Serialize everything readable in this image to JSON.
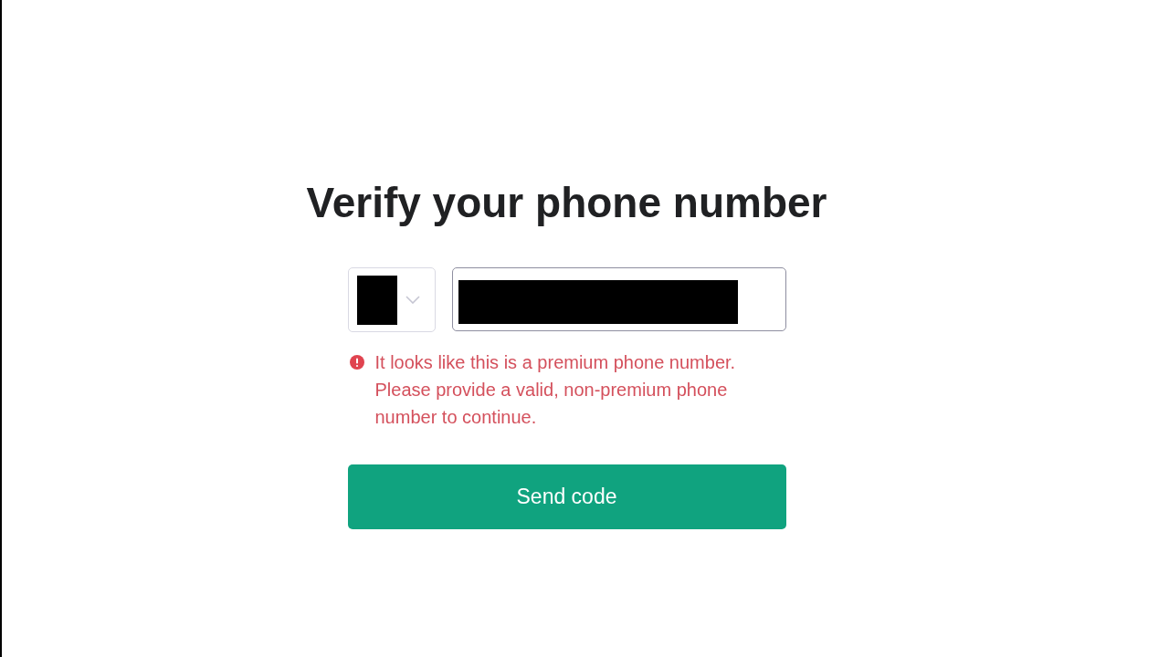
{
  "heading": "Verify your phone number",
  "country_select": {
    "redacted": true
  },
  "phone_field": {
    "redacted": true
  },
  "error": {
    "kind": "error",
    "text": "It looks like this is a premium phone number. Please provide a valid, non-premium phone number to continue."
  },
  "submit_button": {
    "label": "Send code"
  }
}
